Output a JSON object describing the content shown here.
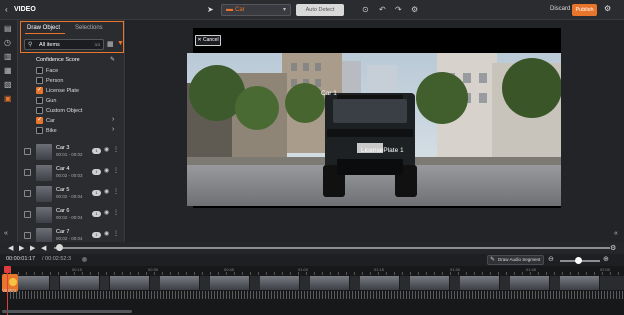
{
  "header": {
    "back_icon": "chevron-left-icon",
    "title": "VIDEO",
    "object_select_value": "Car",
    "auto_detect_label": "Auto Detect",
    "discard_label": "Discard",
    "publish_label": "Publish"
  },
  "panel": {
    "tabs": [
      "Draw Object",
      "Selections"
    ],
    "search_value": "All items",
    "search_count": "3/3",
    "confidence_title": "Confidence Score",
    "categories": [
      {
        "label": "Face",
        "checked": false,
        "expandable": false
      },
      {
        "label": "Person",
        "checked": false,
        "expandable": false
      },
      {
        "label": "License Plate",
        "checked": true,
        "expandable": false
      },
      {
        "label": "Gun",
        "checked": false,
        "expandable": false
      },
      {
        "label": "Custom Object",
        "checked": false,
        "expandable": false
      },
      {
        "label": "Car",
        "checked": true,
        "expandable": true
      },
      {
        "label": "Bike",
        "checked": false,
        "expandable": true
      }
    ],
    "tracks": [
      {
        "name": "Car 3",
        "time": "00:01 - 00:02",
        "badge": "1"
      },
      {
        "name": "Car 4",
        "time": "00:02 - 00:03",
        "badge": "1"
      },
      {
        "name": "Car 5",
        "time": "00:02 - 00:04",
        "badge": "1"
      },
      {
        "name": "Car 6",
        "time": "00:02 - 00:04",
        "badge": "1"
      },
      {
        "name": "Car 7",
        "time": "00:02 - 00:04",
        "badge": "1"
      }
    ]
  },
  "stage": {
    "cancel_label": "✕ Cancel",
    "annotations": [
      "Car 1",
      "LicensePlate 1"
    ]
  },
  "playback": {
    "current_time": "00:00:01:17",
    "total_time": "/ 00:02:52:3",
    "audio_segment_label": "Draw Audio Segment",
    "ruler_ticks": [
      "00:15",
      "00:30",
      "00:45",
      "01:00",
      "01:15",
      "01:30",
      "01:45",
      "02:00"
    ],
    "track_label": "VIDEO"
  },
  "colors": {
    "accent": "#e8752c",
    "playhead": "#e23b3b",
    "background": "#1e1f22"
  }
}
